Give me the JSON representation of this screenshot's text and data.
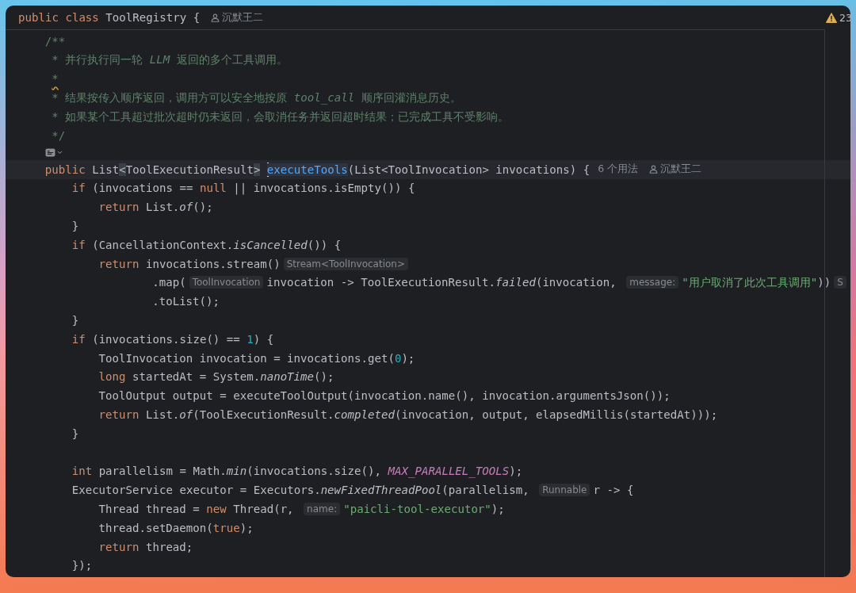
{
  "header": {
    "tokens": [
      {
        "t": "public",
        "kind": "keyword"
      },
      {
        "t": " class",
        "kind": "keyword"
      },
      {
        "t": " ToolRegistry {",
        "kind": "plain"
      },
      {
        "t": "沉默王二",
        "kind": "author"
      }
    ]
  },
  "problems": {
    "count": "23"
  },
  "lines": [
    {
      "kind": "code",
      "tokens": [
        {
          "t": "/**",
          "kind": "doc"
        }
      ]
    },
    {
      "kind": "doc-continuation",
      "tokens": [
        {
          "t": "* 并行执行同一轮 ",
          "kind": "doc"
        },
        {
          "t": "LLM",
          "kind": "doc-code"
        },
        {
          "t": " 返回的多个工具调用。",
          "kind": "doc"
        }
      ]
    },
    {
      "kind": "doc-continuation",
      "tokens": [
        {
          "t": "*",
          "kind": "doc-typo"
        }
      ]
    },
    {
      "kind": "doc-continuation",
      "tokens": [
        {
          "t": "* 结果按传入顺序返回，调用方可以安全地按原 ",
          "kind": "doc"
        },
        {
          "t": "tool_call",
          "kind": "doc-code"
        },
        {
          "t": " 顺序回灌消息历史。",
          "kind": "doc"
        }
      ]
    },
    {
      "kind": "doc-continuation",
      "tokens": [
        {
          "t": "* 如果某个工具超过批次超时仍未返回，会取消任务并返回超时结果；已完成工具不受影响。",
          "kind": "doc"
        }
      ]
    },
    {
      "kind": "doc-continuation",
      "tokens": [
        {
          "t": "*/",
          "kind": "doc"
        }
      ]
    },
    {
      "kind": "icon"
    },
    {
      "kind": "code",
      "current": true,
      "tokens": [
        {
          "t": "public",
          "kind": "keyword"
        },
        {
          "t": " List",
          "kind": "plain"
        },
        {
          "t": "<",
          "kind": "brace-match"
        },
        {
          "t": "ToolExecutionResult",
          "kind": "plain"
        },
        {
          "t": ">",
          "kind": "brace-match"
        },
        {
          "t": "executeTools",
          "kind": "declaration",
          "caret": true
        },
        {
          "t": "(List<ToolInvocation> invocations) {",
          "kind": "plain"
        },
        {
          "t": "6 个用法",
          "kind": "usages"
        },
        {
          "t": "沉默王二",
          "kind": "author"
        }
      ],
      "children": [
        {
          "kind": "code",
          "tokens": [
            {
              "t": "if",
              "kind": "keyword"
            },
            {
              "t": " (invocations == ",
              "kind": "plain"
            },
            {
              "t": "null",
              "kind": "keyword"
            },
            {
              "t": " || invocations.isEmpty()) {",
              "kind": "plain"
            }
          ],
          "children": [
            {
              "kind": "code",
              "tokens": [
                {
                  "t": "return",
                  "kind": "keyword"
                },
                {
                  "t": " List.",
                  "kind": "plain"
                },
                {
                  "t": "of",
                  "kind": "static-call"
                },
                {
                  "t": "();",
                  "kind": "plain"
                }
              ]
            }
          ]
        },
        {
          "kind": "code",
          "tokens": [
            {
              "t": "}",
              "kind": "plain"
            }
          ]
        },
        {
          "kind": "code",
          "tokens": [
            {
              "t": "if",
              "kind": "keyword"
            },
            {
              "t": " (CancellationContext.",
              "kind": "plain"
            },
            {
              "t": "isCancelled",
              "kind": "static-call"
            },
            {
              "t": "()) {",
              "kind": "plain"
            }
          ],
          "children": [
            {
              "kind": "code",
              "tokens": [
                {
                  "t": "return",
                  "kind": "keyword"
                },
                {
                  "t": " invocations.stream()",
                  "kind": "plain"
                },
                {
                  "t": "Stream<ToolInvocation>",
                  "kind": "hint"
                }
              ],
              "children": [
                {
                  "kind": "continuation",
                  "tokens": [
                    {
                      "t": ".map(",
                      "kind": "plain"
                    },
                    {
                      "t": "ToolInvocation",
                      "kind": "hint"
                    },
                    {
                      "t": "invocation -> ToolExecutionResult.",
                      "kind": "plain"
                    },
                    {
                      "t": "failed",
                      "kind": "static-call"
                    },
                    {
                      "t": "(invocation, ",
                      "kind": "plain"
                    },
                    {
                      "t": "message:",
                      "kind": "hint"
                    },
                    {
                      "t": "\"用户取消了此次工具调用\"",
                      "kind": "string"
                    },
                    {
                      "t": "))",
                      "kind": "plain"
                    },
                    {
                      "t": "S",
                      "kind": "hint"
                    }
                  ]
                },
                {
                  "kind": "continuation",
                  "tokens": [
                    {
                      "t": ".toList();",
                      "kind": "plain"
                    }
                  ]
                }
              ]
            }
          ]
        },
        {
          "kind": "code",
          "tokens": [
            {
              "t": "}",
              "kind": "plain"
            }
          ]
        },
        {
          "kind": "code",
          "tokens": [
            {
              "t": "if",
              "kind": "keyword"
            },
            {
              "t": " (invocations.size() == ",
              "kind": "plain"
            },
            {
              "t": "1",
              "kind": "number"
            },
            {
              "t": ") {",
              "kind": "plain"
            }
          ],
          "children": [
            {
              "kind": "code",
              "tokens": [
                {
                  "t": "ToolInvocation invocation = invocations.get(",
                  "kind": "plain"
                },
                {
                  "t": "0",
                  "kind": "number"
                },
                {
                  "t": ");",
                  "kind": "plain"
                }
              ]
            },
            {
              "kind": "code",
              "tokens": [
                {
                  "t": "long",
                  "kind": "keyword"
                },
                {
                  "t": " startedAt = System.",
                  "kind": "plain"
                },
                {
                  "t": "nanoTime",
                  "kind": "static-call"
                },
                {
                  "t": "();",
                  "kind": "plain"
                }
              ]
            },
            {
              "kind": "code",
              "tokens": [
                {
                  "t": "ToolOutput output = executeToolOutput(invocation.name(), invocation.argumentsJson());",
                  "kind": "plain"
                }
              ]
            },
            {
              "kind": "code",
              "tokens": [
                {
                  "t": "return",
                  "kind": "keyword"
                },
                {
                  "t": " List.",
                  "kind": "plain"
                },
                {
                  "t": "of",
                  "kind": "static-call"
                },
                {
                  "t": "(ToolExecutionResult.",
                  "kind": "plain"
                },
                {
                  "t": "completed",
                  "kind": "static-call"
                },
                {
                  "t": "(invocation, output, elapsedMillis(startedAt)));",
                  "kind": "plain"
                }
              ]
            }
          ]
        },
        {
          "kind": "code",
          "tokens": [
            {
              "t": "}",
              "kind": "plain"
            }
          ]
        },
        {
          "kind": "blank"
        },
        {
          "kind": "code",
          "tokens": [
            {
              "t": "int",
              "kind": "keyword"
            },
            {
              "t": " parallelism = Math.",
              "kind": "plain"
            },
            {
              "t": "min",
              "kind": "static-call"
            },
            {
              "t": "(invocations.size(), ",
              "kind": "plain"
            },
            {
              "t": "MAX_PARALLEL_TOOLS",
              "kind": "constant"
            },
            {
              "t": ");",
              "kind": "plain"
            }
          ]
        },
        {
          "kind": "code",
          "tokens": [
            {
              "t": "ExecutorService executor = Executors.",
              "kind": "plain"
            },
            {
              "t": "newFixedThreadPool",
              "kind": "static-call"
            },
            {
              "t": "(parallelism, ",
              "kind": "plain"
            },
            {
              "t": "Runnable",
              "kind": "hint"
            },
            {
              "t": "r -> {",
              "kind": "plain"
            }
          ],
          "children": [
            {
              "kind": "code",
              "tokens": [
                {
                  "t": "Thread thread = ",
                  "kind": "plain"
                },
                {
                  "t": "new",
                  "kind": "keyword"
                },
                {
                  "t": " Thread(r, ",
                  "kind": "plain"
                },
                {
                  "t": "name:",
                  "kind": "hint"
                },
                {
                  "t": "\"paicli-tool-executor\"",
                  "kind": "string"
                },
                {
                  "t": ");",
                  "kind": "plain"
                }
              ]
            },
            {
              "kind": "code",
              "tokens": [
                {
                  "t": "thread.setDaemon(",
                  "kind": "plain"
                },
                {
                  "t": "true",
                  "kind": "keyword"
                },
                {
                  "t": ");",
                  "kind": "plain"
                }
              ]
            },
            {
              "kind": "code",
              "tokens": [
                {
                  "t": "return",
                  "kind": "keyword"
                },
                {
                  "t": " thread;",
                  "kind": "plain"
                }
              ]
            }
          ]
        },
        {
          "kind": "code",
          "tokens": [
            {
              "t": "});",
              "kind": "plain"
            }
          ]
        }
      ]
    }
  ]
}
